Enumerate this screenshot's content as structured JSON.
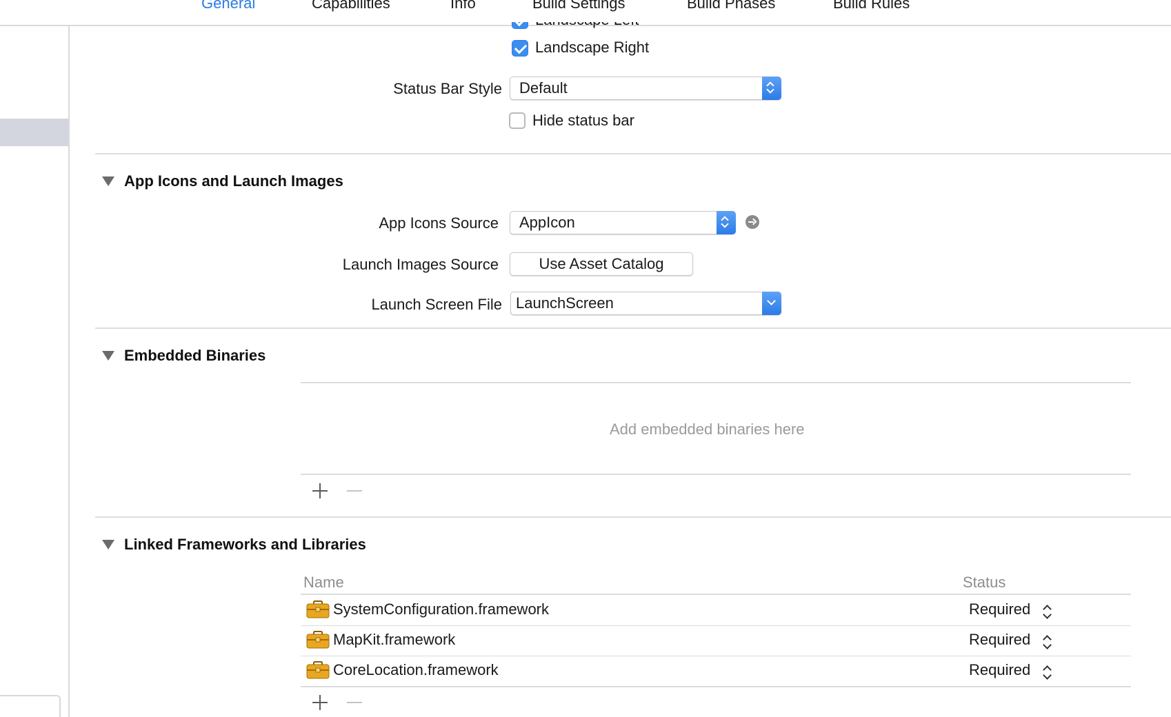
{
  "tabs": [
    {
      "label": "General",
      "active": true
    },
    {
      "label": "Capabilities",
      "active": false
    },
    {
      "label": "Info",
      "active": false
    },
    {
      "label": "Build Settings",
      "active": false
    },
    {
      "label": "Build Phases",
      "active": false
    },
    {
      "label": "Build Rules",
      "active": false
    }
  ],
  "deployment": {
    "orientation_partial_label": "Landscape Left",
    "orientation_landscape_right": {
      "label": "Landscape Right",
      "checked": true
    },
    "status_bar_style": {
      "label": "Status Bar Style",
      "value": "Default"
    },
    "hide_status_bar": {
      "label": "Hide status bar",
      "checked": false
    }
  },
  "app_icons": {
    "title": "App Icons and Launch Images",
    "icons_source": {
      "label": "App Icons Source",
      "value": "AppIcon"
    },
    "launch_images_source": {
      "label": "Launch Images Source",
      "button": "Use Asset Catalog"
    },
    "launch_screen_file": {
      "label": "Launch Screen File",
      "value": "LaunchScreen"
    }
  },
  "embedded": {
    "title": "Embedded Binaries",
    "placeholder": "Add embedded binaries here"
  },
  "linked": {
    "title": "Linked Frameworks and Libraries",
    "columns": {
      "name": "Name",
      "status": "Status"
    },
    "rows": [
      {
        "name": "SystemConfiguration.framework",
        "status": "Required"
      },
      {
        "name": "MapKit.framework",
        "status": "Required"
      },
      {
        "name": "CoreLocation.framework",
        "status": "Required"
      }
    ]
  },
  "colors": {
    "accent": "#2b7be3",
    "checkbox_on": "#3b8ef0",
    "framework_icon": "#e8a723"
  },
  "icons": {
    "disclosure": "disclosure-triangle-icon",
    "add": "plus-icon",
    "remove": "minus-icon",
    "goto": "arrow-circle-icon",
    "framework": "toolbox-icon"
  }
}
